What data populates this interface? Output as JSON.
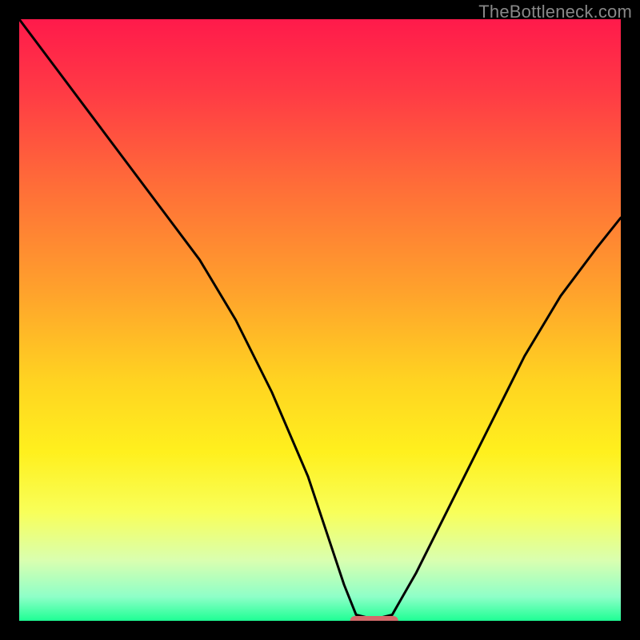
{
  "watermark": "TheBottleneck.com",
  "chart_data": {
    "type": "line",
    "title": "",
    "xlabel": "",
    "ylabel": "",
    "xlim": [
      0,
      100
    ],
    "ylim": [
      0,
      100
    ],
    "background_gradient_stops": [
      {
        "offset": 0.0,
        "color": "#ff1a4b"
      },
      {
        "offset": 0.12,
        "color": "#ff3a45"
      },
      {
        "offset": 0.28,
        "color": "#ff6e38"
      },
      {
        "offset": 0.45,
        "color": "#ffa12c"
      },
      {
        "offset": 0.6,
        "color": "#ffd321"
      },
      {
        "offset": 0.72,
        "color": "#fff01e"
      },
      {
        "offset": 0.82,
        "color": "#f8ff5a"
      },
      {
        "offset": 0.9,
        "color": "#d9ffb0"
      },
      {
        "offset": 0.96,
        "color": "#8effc8"
      },
      {
        "offset": 1.0,
        "color": "#1eff94"
      }
    ],
    "series": [
      {
        "name": "bottleneck-curve",
        "stroke": "#000000",
        "x": [
          0,
          6,
          12,
          18,
          24,
          30,
          36,
          42,
          48,
          54,
          56,
          58,
          60,
          62,
          66,
          72,
          78,
          84,
          90,
          96,
          100
        ],
        "y": [
          100,
          92,
          84,
          76,
          68,
          60,
          50,
          38,
          24,
          6,
          1,
          0.5,
          0.5,
          1,
          8,
          20,
          32,
          44,
          54,
          62,
          67
        ]
      }
    ],
    "marker": {
      "name": "bottleneck-marker",
      "fill": "#d46a6a",
      "x_center": 59,
      "y_center": 0.0,
      "width": 8,
      "height": 1.6
    }
  }
}
